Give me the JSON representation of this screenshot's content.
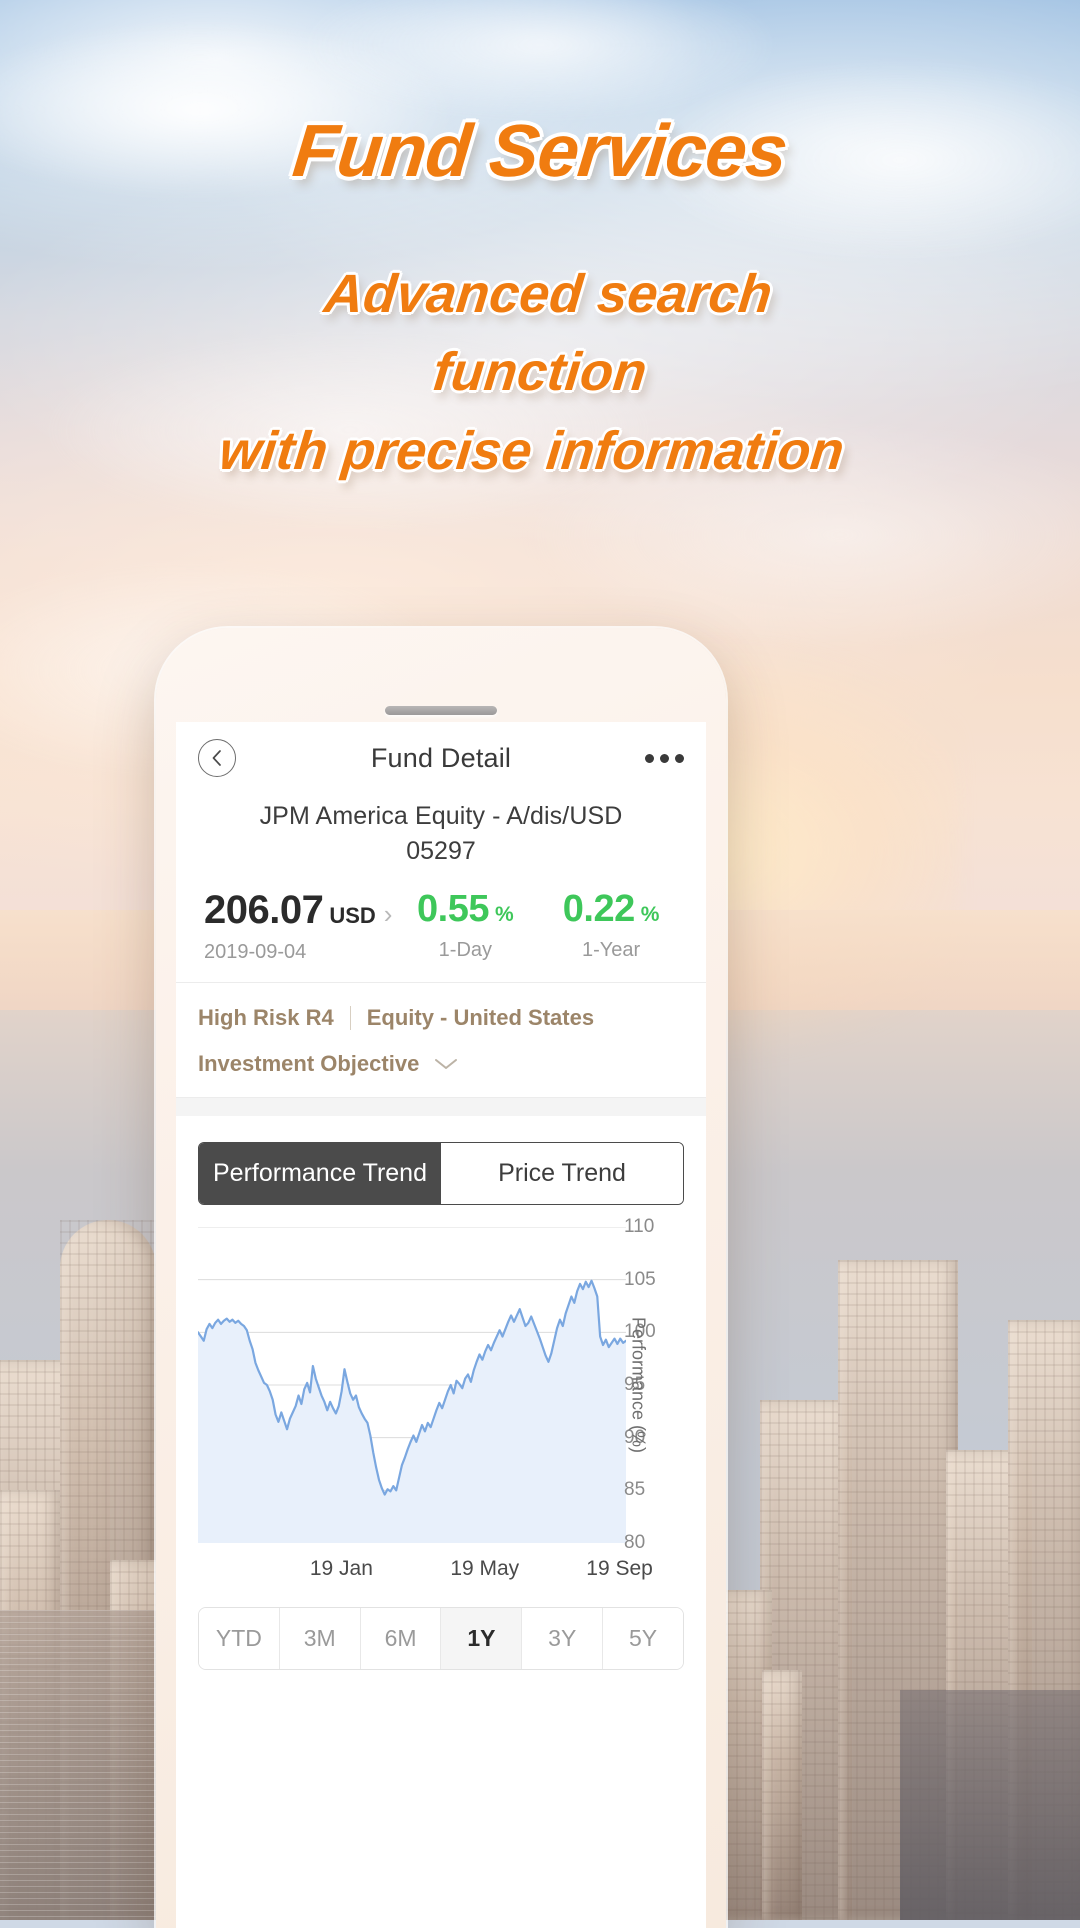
{
  "promo": {
    "headline": "Fund Services",
    "subheadline": "Advanced search\nfunction\nwith precise information",
    "sub_line_1": "Advanced search",
    "sub_line_2": "function",
    "sub_line_3": "with precise information",
    "accent_color": "#f07c10"
  },
  "app": {
    "nav": {
      "back_icon": "chevron-left-icon",
      "title": "Fund Detail",
      "more_icon": "more-horizontal-icon"
    },
    "fund": {
      "name": "JPM America Equity - A/dis/USD",
      "code": "05297",
      "nav_price": "206.07",
      "currency": "USD",
      "nav_date": "2019-09-04",
      "one_day_change": "0.55",
      "one_day_symbol": "%",
      "one_day_label": "1-Day",
      "one_year_change": "0.22",
      "one_year_symbol": "%",
      "one_year_label": "1-Year",
      "change_color": "#3ec75a",
      "risk_level": "High Risk  R4",
      "category": "Equity - United States",
      "objective_label": "Investment Objective",
      "objective_chevron": "chevron-down-icon",
      "risk_color": "#9c8569"
    },
    "chart_tabs": [
      {
        "label": "Performance Trend",
        "active": true
      },
      {
        "label": "Price Trend",
        "active": false
      }
    ],
    "periods": [
      {
        "label": "YTD",
        "active": false
      },
      {
        "label": "3M",
        "active": false
      },
      {
        "label": "6M",
        "active": false
      },
      {
        "label": "1Y",
        "active": true
      },
      {
        "label": "3Y",
        "active": false
      },
      {
        "label": "5Y",
        "active": false
      }
    ]
  },
  "chart_data": {
    "type": "line",
    "title": "",
    "xlabel": "",
    "ylabel": "Performance (%)",
    "ylim": [
      80,
      110
    ],
    "yticks": [
      80,
      85,
      90,
      95,
      100,
      105,
      110
    ],
    "ytick_labels": [
      "80",
      "85",
      "90",
      "95",
      "100",
      "105",
      "110"
    ],
    "xticks": [
      "19 Jan",
      "19 May",
      "19 Sep"
    ],
    "xtick_positions_pct": [
      33.5,
      67.0,
      98.5
    ],
    "grid": true,
    "legend": false,
    "line_color": "#7aa7e0",
    "fill_color": "#e8f0fb",
    "series": [
      {
        "name": "Performance",
        "values": [
          100.0,
          99.6,
          99.2,
          100.3,
          100.8,
          100.4,
          100.9,
          101.2,
          100.8,
          101.1,
          101.3,
          101.0,
          101.2,
          100.9,
          101.1,
          100.8,
          100.6,
          100.2,
          99.2,
          98.4,
          97.1,
          96.4,
          95.8,
          95.2,
          95.0,
          94.4,
          93.6,
          92.2,
          91.5,
          92.4,
          91.6,
          90.8,
          91.8,
          92.4,
          93.0,
          94.0,
          93.2,
          94.6,
          95.2,
          94.3,
          96.8,
          95.6,
          94.8,
          94.0,
          93.4,
          92.6,
          93.4,
          92.8,
          92.3,
          93.0,
          94.4,
          96.5,
          95.3,
          94.2,
          93.6,
          94.0,
          92.9,
          92.3,
          91.8,
          91.4,
          90.2,
          88.6,
          87.2,
          86.0,
          85.2,
          84.6,
          85.1,
          84.9,
          85.4,
          85.0,
          86.2,
          87.4,
          88.1,
          88.9,
          89.6,
          90.2,
          89.6,
          90.4,
          91.2,
          90.6,
          91.4,
          91.0,
          91.8,
          92.6,
          93.3,
          92.8,
          93.6,
          94.4,
          95.0,
          94.2,
          95.4,
          95.1,
          94.7,
          95.6,
          96.0,
          95.3,
          96.4,
          97.2,
          97.9,
          97.4,
          98.2,
          98.8,
          98.3,
          99.0,
          99.6,
          100.2,
          99.6,
          100.3,
          101.0,
          101.6,
          101.0,
          101.6,
          102.2,
          101.4,
          100.6,
          100.9,
          101.5,
          100.8,
          100.1,
          99.4,
          98.6,
          97.8,
          97.2,
          98.0,
          99.2,
          100.4,
          101.2,
          100.6,
          101.8,
          102.6,
          103.4,
          102.8,
          103.9,
          104.6,
          104.1,
          104.8,
          104.3,
          104.9,
          104.2,
          103.4,
          99.6,
          98.8,
          99.3,
          98.6,
          99.0,
          99.4,
          98.9,
          99.4,
          99.0,
          99.2
        ]
      }
    ]
  }
}
